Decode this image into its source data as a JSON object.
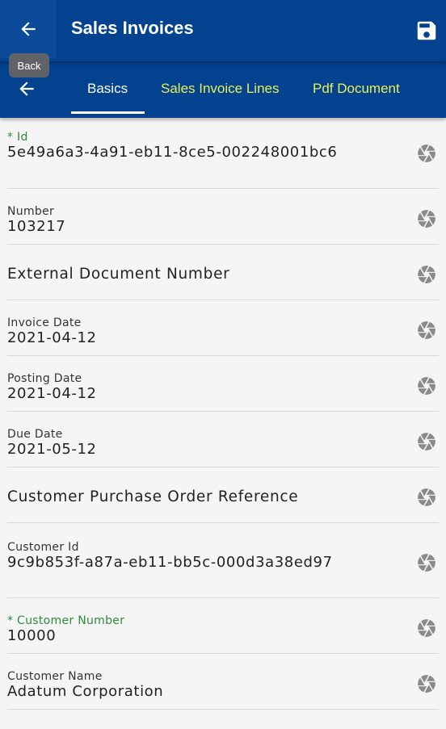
{
  "header": {
    "title": "Sales Invoices",
    "tooltip": "Back"
  },
  "tabs": [
    {
      "label": "Basics",
      "active": true
    },
    {
      "label": "Sales Invoice Lines",
      "active": false
    },
    {
      "label": "Pdf Document",
      "active": false
    }
  ],
  "fields": {
    "id": {
      "label": "* Id",
      "value": "5e49a6a3-4a91-eb11-8ce5-002248001bc6"
    },
    "number": {
      "label": "Number",
      "value": "103217"
    },
    "external_document_number": {
      "label": "External Document Number"
    },
    "invoice_date": {
      "label": "Invoice Date",
      "value": "2021-04-12"
    },
    "posting_date": {
      "label": "Posting Date",
      "value": "2021-04-12"
    },
    "due_date": {
      "label": "Due Date",
      "value": "2021-05-12"
    },
    "customer_purchase_order_reference": {
      "label": "Customer Purchase Order Reference"
    },
    "customer_id": {
      "label": "Customer Id",
      "value": "9c9b853f-a87a-eb11-bb5c-000d3a38ed97"
    },
    "customer_number": {
      "label": "* Customer Number",
      "value": "10000"
    },
    "customer_name": {
      "label": "Customer Name",
      "value": "Adatum Corporation"
    }
  },
  "colors": {
    "appbar": "#02428f",
    "tab_inactive_text": "#e8f05a",
    "required_label": "#2e8b3a"
  }
}
